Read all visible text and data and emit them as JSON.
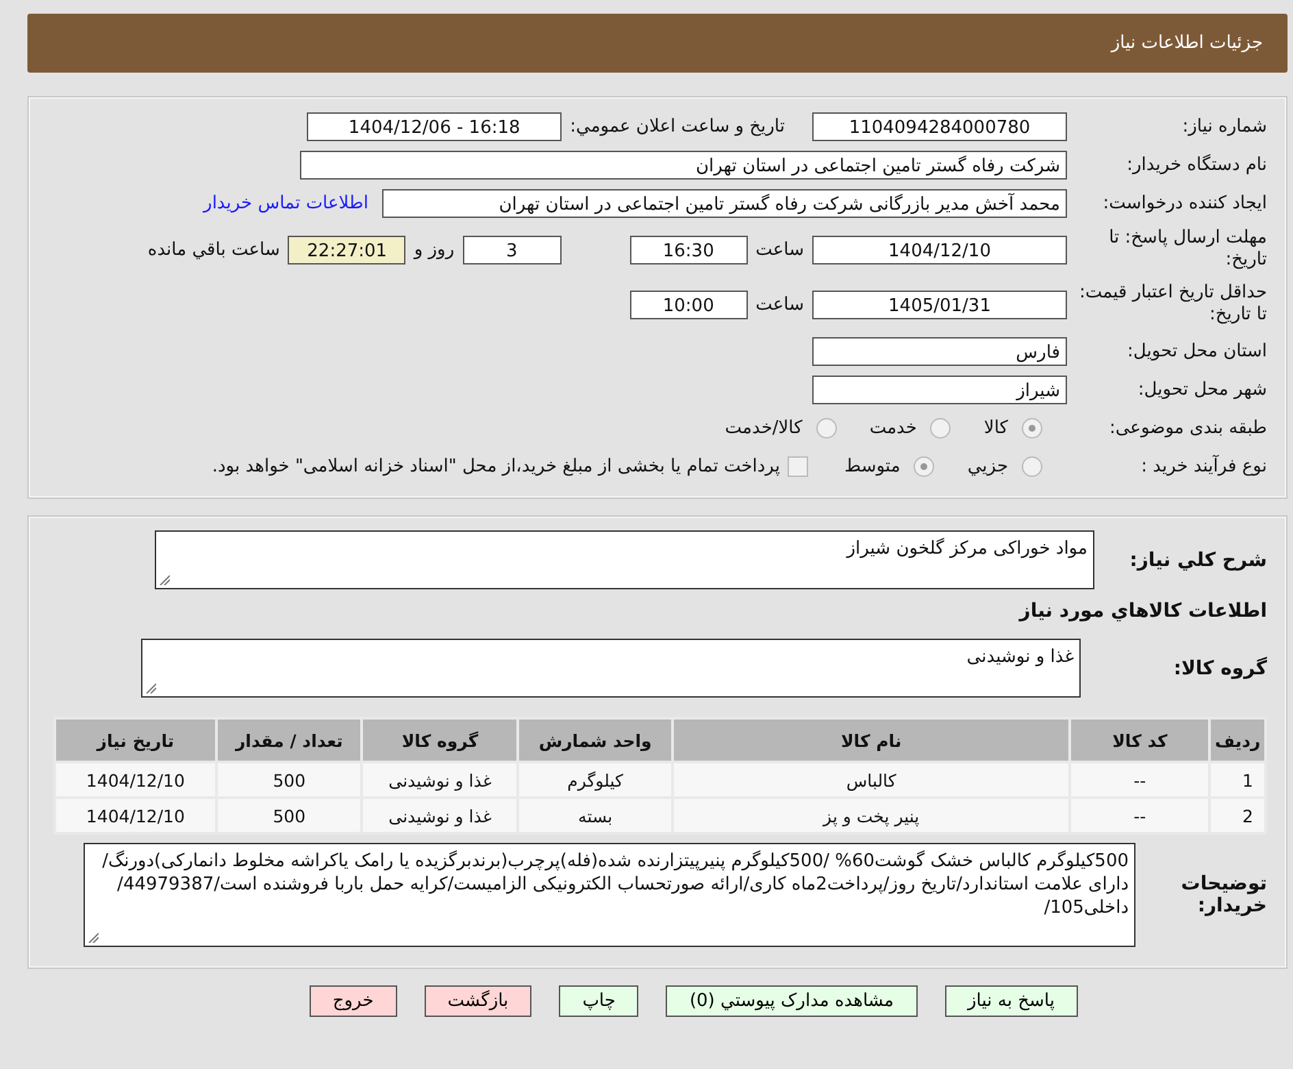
{
  "header": {
    "title": "جزئیات اطلاعات نیاز"
  },
  "need_number": {
    "label": "شماره نیاز:",
    "value": "1104094284000780"
  },
  "announce": {
    "label": "تاریخ و ساعت اعلان عمومي:",
    "value": "1404/12/06 - 16:18"
  },
  "buyer_org": {
    "label": "نام دستگاه خریدار:",
    "value": "شرکت رفاه گستر تامین اجتماعی در استان تهران"
  },
  "requester": {
    "label": "ایجاد کننده درخواست:",
    "value": "محمد آخش مدیر بازرگانی شرکت رفاه گستر تامین اجتماعی در استان تهران",
    "link": "اطلاعات تماس خریدار"
  },
  "deadline": {
    "label": "مهلت ارسال پاسخ: تا تاریخ:",
    "date": "1404/12/10",
    "time_label": "ساعت",
    "time": "16:30",
    "days": "3",
    "days_label": "روز و",
    "remaining": "22:27:01",
    "remaining_label": "ساعت باقي مانده"
  },
  "validity": {
    "label": "حداقل تاریخ اعتبار قیمت: تا تاریخ:",
    "date": "1405/01/31",
    "time_label": "ساعت",
    "time": "10:00"
  },
  "province": {
    "label": "استان محل تحویل:",
    "value": "فارس"
  },
  "city": {
    "label": "شهر محل تحویل:",
    "value": "شیراز"
  },
  "category": {
    "label": "طبقه بندی موضوعی:",
    "options": [
      {
        "label": "کالا",
        "selected": true
      },
      {
        "label": "خدمت",
        "selected": false
      },
      {
        "label": "کالا/خدمت",
        "selected": false
      }
    ]
  },
  "process": {
    "label": "نوع فرآیند خرید :",
    "options": [
      {
        "label": "جزيي",
        "selected": false
      },
      {
        "label": "متوسط",
        "selected": true
      }
    ],
    "treasury": {
      "checked": false,
      "text": "پرداخت تمام یا بخشی از مبلغ خرید،از محل \"اسناد خزانه اسلامی\" خواهد بود."
    }
  },
  "description": {
    "label": "شرح کلي نیاز:",
    "value": "مواد خوراکی مرکز گلخون شیراز"
  },
  "goods_title": "اطلاعات کالاهاي مورد نیاز",
  "goods_group": {
    "label": "گروه کالا:",
    "value": "غذا و نوشیدنی"
  },
  "table": {
    "columns": [
      "ردیف",
      "کد کالا",
      "نام کالا",
      "واحد شمارش",
      "گروه کالا",
      "تعداد / مقدار",
      "تاریخ نیاز"
    ],
    "rows": [
      [
        "1",
        "--",
        "کالباس",
        "کیلوگرم",
        "غذا و نوشیدنی",
        "500",
        "1404/12/10"
      ],
      [
        "2",
        "--",
        "پنیر پخت و پز",
        "بسته",
        "غذا و نوشیدنی",
        "500",
        "1404/12/10"
      ]
    ]
  },
  "buyer_notes": {
    "label": "توضیحات خریدار:",
    "value": "500کیلوگرم کالباس خشک گوشت60% /500کیلوگرم پنیرپیتزارنده شده(فله)پرچرب(برندبرگزیده یا رامک یاکراشه مخلوط دانمارکی)دورنگ/دارای علامت استاندارد/تاریخ روز/پرداخت2ماه کاری/ارائه صورتحساب الکترونیکی الزامیست/کرایه حمل باربا فروشنده است/44979387/داخلی105/"
  },
  "buttons": [
    {
      "label": "پاسخ به نیاز",
      "kind": "primary"
    },
    {
      "label": "مشاهده مدارک پیوستي (0)",
      "kind": "primary"
    },
    {
      "label": "چاپ",
      "kind": "primary"
    },
    {
      "label": "بازگشت",
      "kind": "danger"
    },
    {
      "label": "خروج",
      "kind": "danger"
    }
  ]
}
